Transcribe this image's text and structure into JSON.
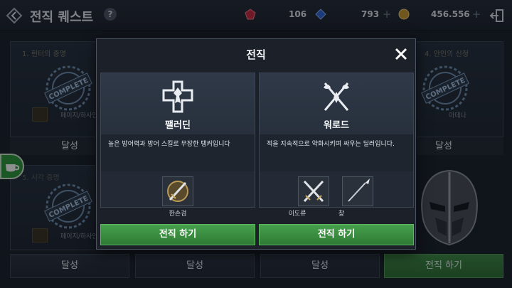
{
  "header": {
    "title": "전직 퀘스트",
    "help_label": "?",
    "gems": "106",
    "crystals": "793",
    "gold": "456.556",
    "plus": "+"
  },
  "background_cards": {
    "c1_title": "1. 헌터의 증명",
    "c1_sub": "페이지/하사인",
    "c4_title": "4. 안인의 신청",
    "c4_sub": "아데나",
    "c5_title": "5. 시각 증명",
    "c5_sub": "페이지/하사인",
    "stamp_text": "COMPLETE"
  },
  "bottom_buttons": {
    "done": "달성",
    "change_job": "전직 하기"
  },
  "modal": {
    "title": "전직",
    "classes": [
      {
        "name": "팰러딘",
        "description": "높은 방어력과 방어 스킬로 무장한 탱커입니다",
        "weapons": [
          "한손검"
        ],
        "button": "전직 하기"
      },
      {
        "name": "워로드",
        "description": "적을 지속적으로 약화시키며 싸우는 딜러입니다.",
        "weapons": [
          "이도류",
          "창"
        ],
        "button": "전직 하기"
      }
    ]
  },
  "colors": {
    "accent_green": "#3f8f45",
    "panel_bg": "#232a35",
    "frame_border": "#4a5463"
  }
}
